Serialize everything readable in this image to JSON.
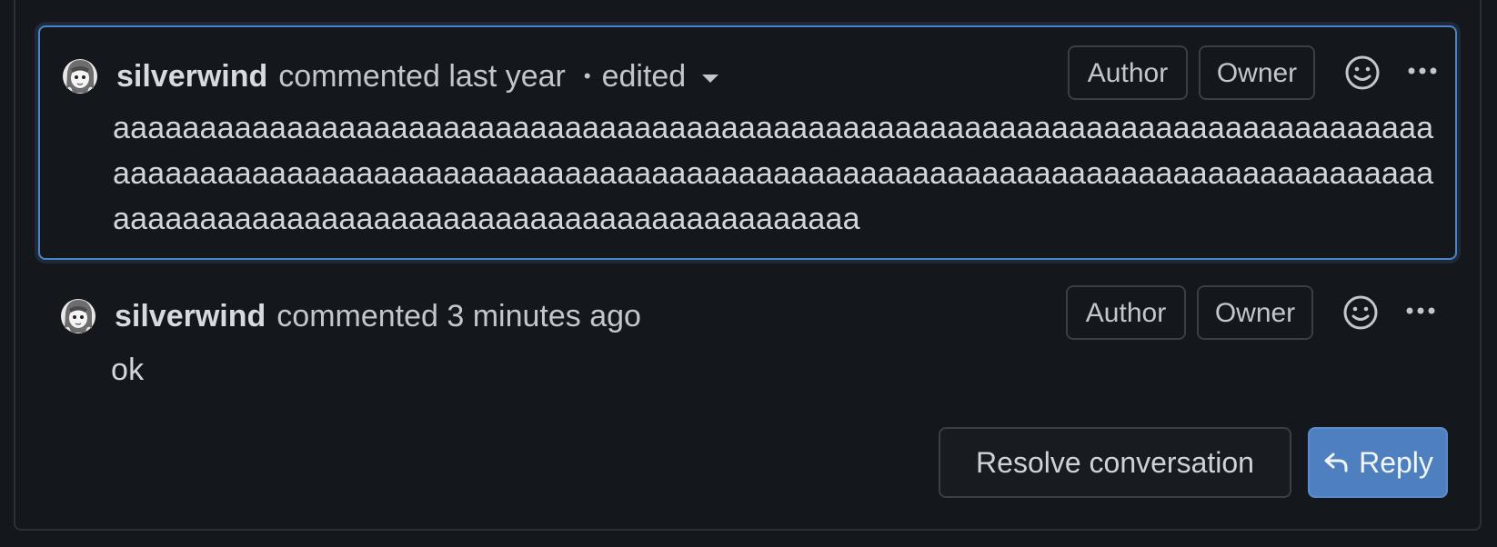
{
  "thread": {
    "comments": [
      {
        "author": "silverwind",
        "action": "commented",
        "time": "last year",
        "edited_label": "edited",
        "badges": [
          "Author",
          "Owner"
        ],
        "body": "aaaaaaaaaaaaaaaaaaaaaaaaaaaaaaaaaaaaaaaaaaaaaaaaaaaaaaaaaaaaaaaaaaaaaaaaaaaaaaaaaaaaaaaaaaaaaaaaaaaaaaaaaaaaaaaaaaaaaaaaaaaaaaaaaaaaaaaaaaaaaaaaaaaaaaaaaaaaaaaaaaaaaaaaaaaaaaaaaaaaaaaaaaaaaaaaaaa"
      },
      {
        "author": "silverwind",
        "action": "commented",
        "time": "3 minutes ago",
        "badges": [
          "Author",
          "Owner"
        ],
        "body": "ok"
      }
    ],
    "actions": {
      "resolve_label": "Resolve conversation",
      "reply_label": "Reply"
    }
  },
  "icons": {
    "avatar": "avatar-icon",
    "reaction": "smiley-icon",
    "more": "kebab-horizontal-icon",
    "reply": "reply-arrow-icon",
    "edited_dropdown": "triangle-down-icon"
  },
  "colors": {
    "background": "#14171b",
    "active_border": "#4d83c5",
    "reply_button": "#4e80c0"
  }
}
